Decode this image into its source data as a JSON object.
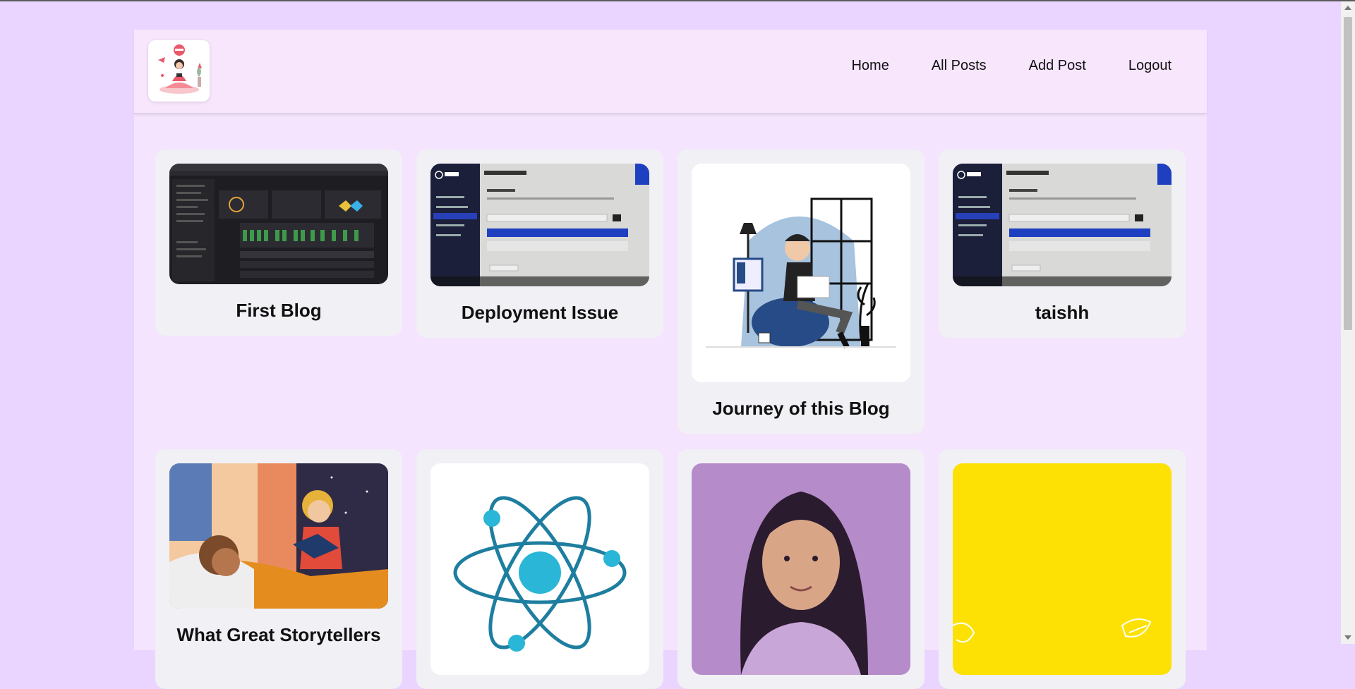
{
  "nav": {
    "home": "Home",
    "all_posts": "All Posts",
    "add_post": "Add Post",
    "logout": "Logout"
  },
  "posts": [
    {
      "title": "First Blog",
      "image": "dark-dashboard-screenshot"
    },
    {
      "title": "Deployment Issue",
      "image": "tiny-approved-domains-photo"
    },
    {
      "title": "Journey of this Blog",
      "image": "man-reading-illustration"
    },
    {
      "title": "taishh",
      "image": "tiny-approved-domains-photo"
    },
    {
      "title": "What Great Storytellers",
      "image": "storytelling-illustration"
    },
    {
      "title": "",
      "image": "atom-icon"
    },
    {
      "title": "",
      "image": "portrait-photo"
    },
    {
      "title": "",
      "image": "yellow-graphic"
    }
  ],
  "colors": {
    "background": "#e9d5ff",
    "panel": "#f5e4fd",
    "card": "#f1f0f5"
  }
}
